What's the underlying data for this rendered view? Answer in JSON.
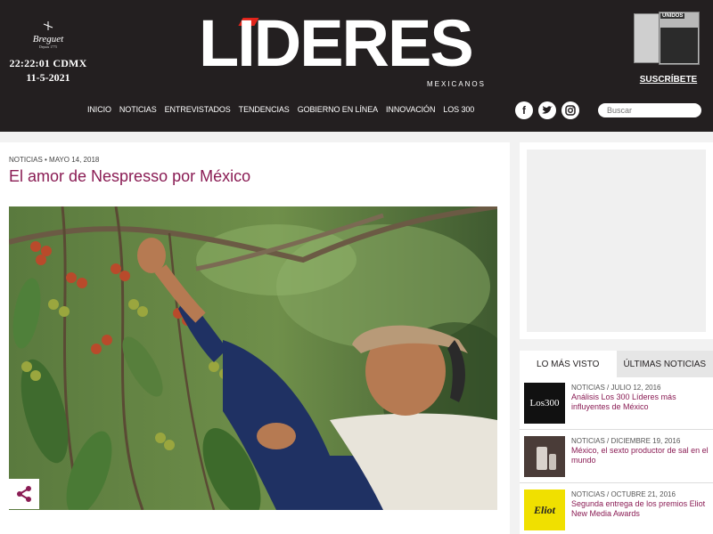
{
  "header": {
    "clock_time": "22:22:01 CDMX",
    "clock_date": "11-5-2021",
    "logo_text": "LIDERES",
    "logo_subtext": "MEXICANOS",
    "subscribe_label": "SUSCRÍBETE",
    "magazine_cover_title": "UNIDOS",
    "nav": [
      "INICIO",
      "NOTICIAS",
      "ENTREVISTADOS",
      "TENDENCIAS",
      "GOBIERNO EN LÍNEA",
      "INNOVACIÓN",
      "LOS 300"
    ],
    "search_placeholder": "Buscar",
    "social_icons": [
      "facebook-icon",
      "twitter-icon",
      "instagram-icon"
    ]
  },
  "article": {
    "category": "NOTICIAS",
    "date": "MAYO 14, 2018",
    "meta": "NOTICIAS • MAYO 14, 2018",
    "title": "El amor de Nespresso por México"
  },
  "sidebar": {
    "tabs": [
      {
        "label": "LO MÁS VISTO",
        "active": true
      },
      {
        "label": "ÚLTIMAS NOTICIAS",
        "active": false
      }
    ],
    "news": [
      {
        "meta": "NOTICIAS / JULIO 12, 2016",
        "title": "Análisis Los 300 Líderes más influyentes de México",
        "thumb_text": "Los300"
      },
      {
        "meta": "NOTICIAS / DICIEMBRE 19, 2016",
        "title": "México, el sexto productor de sal en el mundo",
        "thumb_text": ""
      },
      {
        "meta": "NOTICIAS / OCTUBRE 21, 2016",
        "title": "Segunda entrega de los premios Eliot New Media Awards",
        "thumb_text": "Eliot"
      }
    ]
  },
  "colors": {
    "header_bg": "#231f20",
    "accent_red": "#e2231a",
    "title_magenta": "#8a1c54",
    "share_icon": "#8a1c54"
  }
}
